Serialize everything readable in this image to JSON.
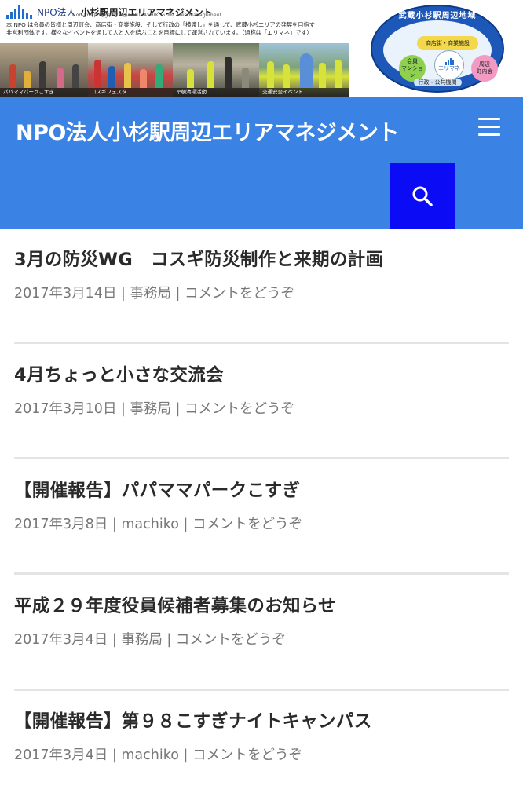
{
  "banner": {
    "org_prefix": "NPO法人",
    "org_name": "小杉駅周辺エリアマネジメント",
    "org_name_en": "Non-Profit Organization MUSASHIKOSUGI Area Management",
    "intro_line1": "本 NPO は会員の皆様と周辺町会、商店街・商業施設、そして行政の「横渡し」を通して、武蔵小杉エリアの発展を目指す",
    "intro_line2": "非営利団体です。様々なイベントを通して人と人を結ぶことを目標にして運営されています。（通称は「エリマネ」です）",
    "photos": [
      {
        "caption": "パパママパークこすぎ"
      },
      {
        "caption": "コスギフェスタ"
      },
      {
        "caption": "早朝清掃活動"
      },
      {
        "caption": "交通安全イベント"
      }
    ]
  },
  "emblem": {
    "top": "武蔵小杉駅周辺地域",
    "shops": "商店街・商業施設",
    "member": "会員\nマンション",
    "center": "エリマネ",
    "town": "周辺\n町内会",
    "bottom": "行政・公共機関"
  },
  "header": {
    "site_title": "NPO法人小杉駅周辺エリアマネジメント",
    "menu_icon": "hamburger-menu-icon",
    "search_icon": "search-icon"
  },
  "colors": {
    "nav_bg": "#3a82e4",
    "search_bg": "#0b0bf5",
    "meta_text": "#777777"
  },
  "posts": [
    {
      "title": "3月の防災WG　コスギ防災制作と来期の計画",
      "date": "2017年3月14日",
      "author": "事務局",
      "comments": "コメントをどうぞ"
    },
    {
      "title": "4月ちょっと小さな交流会",
      "date": "2017年3月10日",
      "author": "事務局",
      "comments": "コメントをどうぞ"
    },
    {
      "title": "【開催報告】パパママパークこすぎ",
      "date": "2017年3月8日",
      "author": "machiko",
      "comments": "コメントをどうぞ"
    },
    {
      "title": "平成２９年度役員候補者募集のお知らせ",
      "date": "2017年3月4日",
      "author": "事務局",
      "comments": "コメントをどうぞ"
    },
    {
      "title": "【開催報告】第９８こすぎナイトキャンパス",
      "date": "2017年3月4日",
      "author": "machiko",
      "comments": "コメントをどうぞ"
    }
  ],
  "meta_separator": " | "
}
